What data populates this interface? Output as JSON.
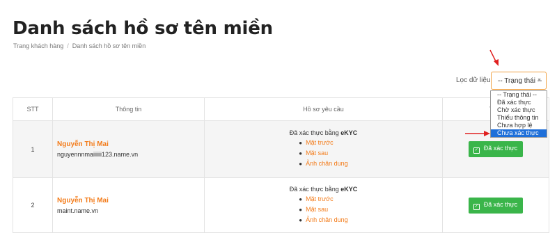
{
  "page": {
    "title": "Danh sách hồ sơ tên miền",
    "breadcrumb": [
      "Trang khách hàng",
      "Danh sách hồ sơ tên miền"
    ],
    "breadcrumb_separator": "/"
  },
  "filter": {
    "label": "Lọc dữ liệu",
    "selected": "-- Trạng thái --",
    "options": [
      "-- Trạng thái --",
      "Đã xác thực",
      "Chờ xác thực",
      "Thiếu thông tin",
      "Chưa hợp lệ",
      "Chưa xác thực"
    ],
    "highlighted_option": "Chưa xác thực"
  },
  "table": {
    "headers": [
      "STT",
      "Thông tin",
      "Hồ sơ yêu cầu",
      "Trạng thái"
    ],
    "header_visible": [
      "STT",
      "Thông tin",
      "Hồ sơ yêu cầu",
      "Trạn"
    ],
    "rows": [
      {
        "stt": "1",
        "name": "Nguyễn Thị Mai",
        "domain": "nguyennnmaiiiiii123.name.vn",
        "doc_title_prefix": "Đã xác thực bằng ",
        "doc_title_method": "eKYC",
        "docs": [
          "Mặt trước",
          "Mặt sau",
          "Ảnh chân dung"
        ],
        "status": "Đã xác thực"
      },
      {
        "stt": "2",
        "name": "Nguyễn Thị Mai",
        "domain": "maint.name.vn",
        "doc_title_prefix": "Đã xác thực bằng ",
        "doc_title_method": "eKYC",
        "docs": [
          "Mặt trước",
          "Mặt sau",
          "Ảnh chân dung"
        ],
        "status": "Đã xác thực"
      }
    ]
  },
  "colors": {
    "accent_orange": "#f37c1b",
    "status_green": "#3ab54a",
    "selection_blue": "#1e6fd9",
    "annotation_red": "#e02020"
  },
  "icons": {
    "status_check": "check-square-icon",
    "select_caret": "caret-down-icon",
    "annotation": "red-arrow-icon"
  }
}
